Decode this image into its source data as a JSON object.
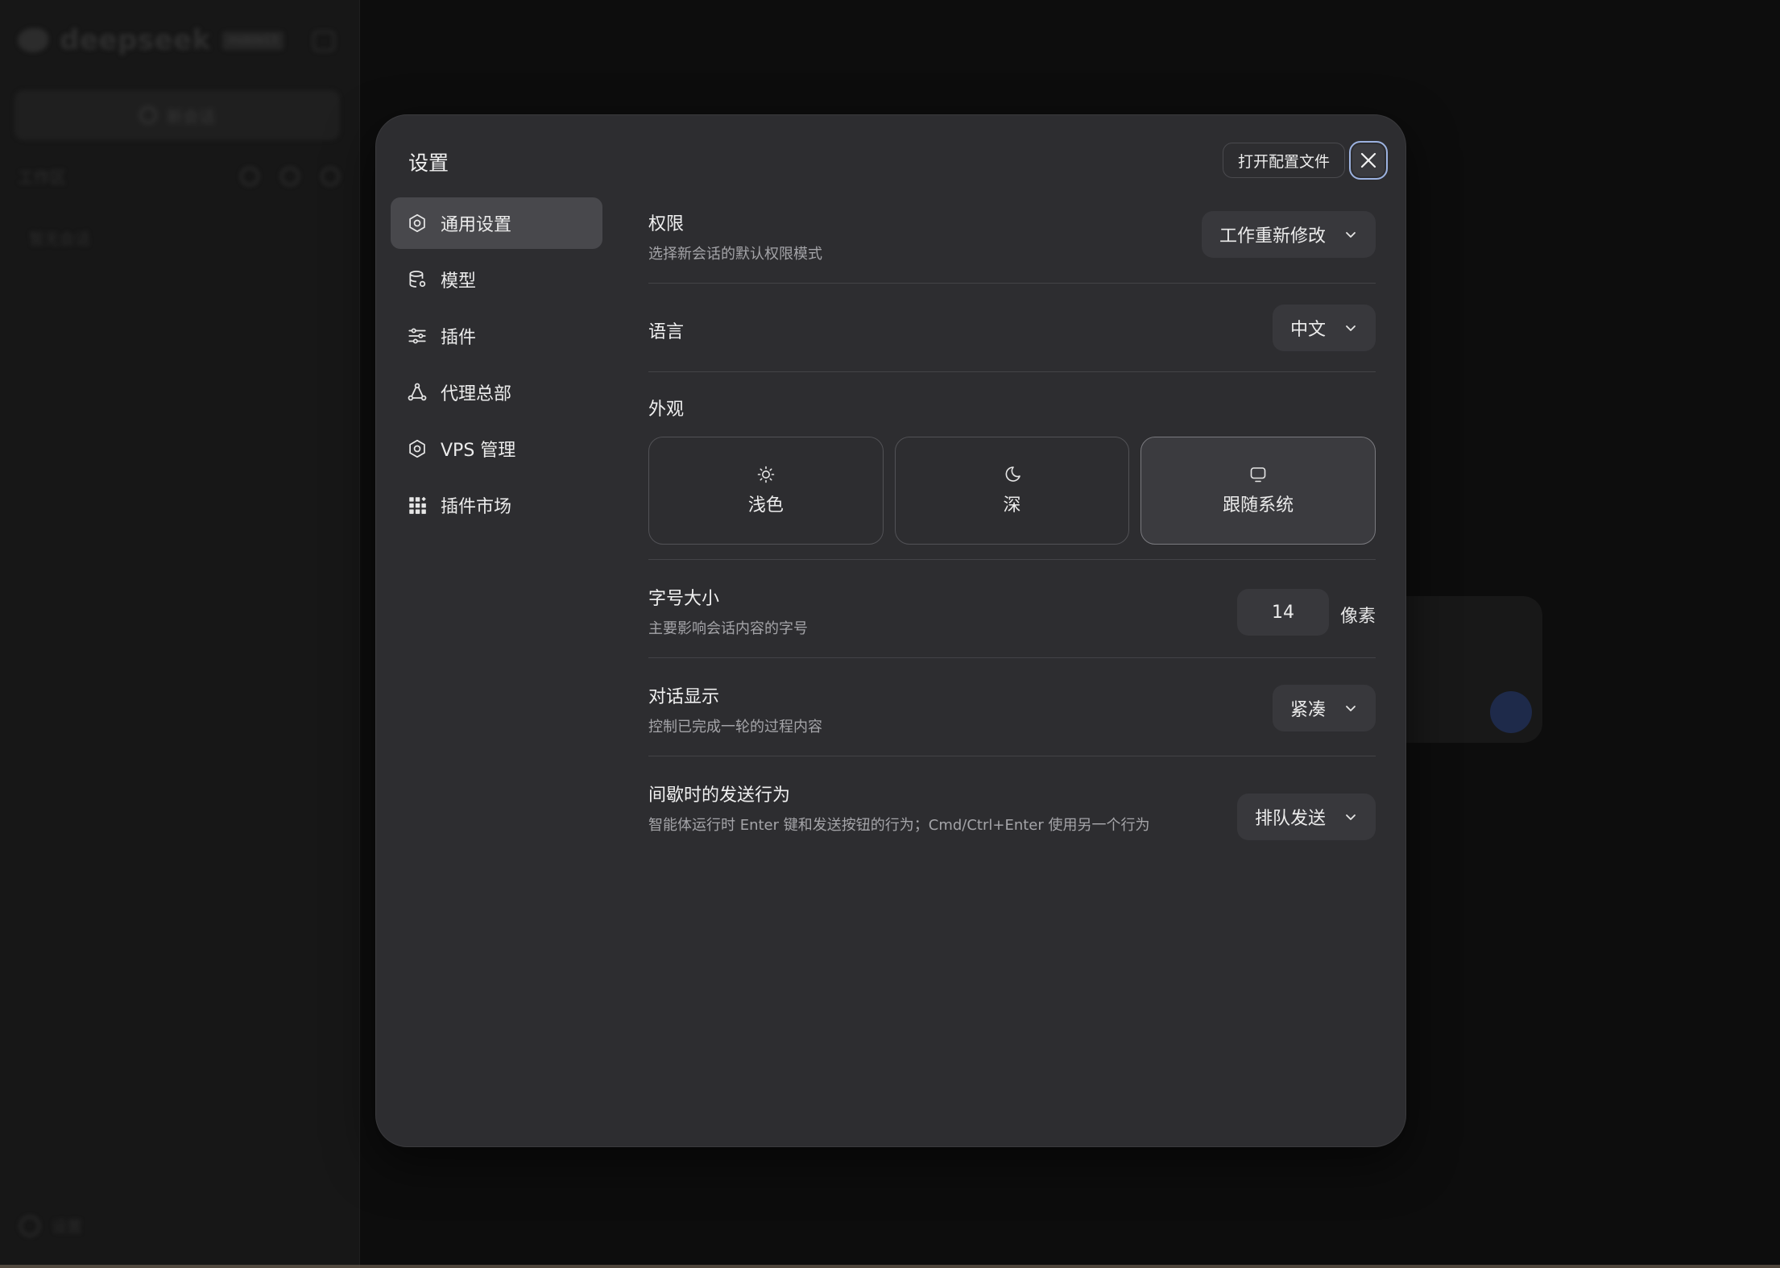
{
  "background": {
    "brand": "deepseek",
    "version": "mobile13",
    "new_chat": "新会话",
    "workspace": "工作区",
    "empty": "暂无会话",
    "settings": "设置"
  },
  "modal": {
    "title": "设置",
    "open_config": "打开配置文件",
    "nav": [
      {
        "label": "通用设置",
        "icon": "gear-icon"
      },
      {
        "label": "模型",
        "icon": "database-icon"
      },
      {
        "label": "插件",
        "icon": "sliders-icon"
      },
      {
        "label": "代理总部",
        "icon": "network-icon"
      },
      {
        "label": "VPS 管理",
        "icon": "gear-icon"
      },
      {
        "label": "插件市场",
        "icon": "grid-icon"
      }
    ],
    "permission": {
      "label": "权限",
      "desc": "选择新会话的默认权限模式",
      "value": "工作重新修改"
    },
    "language": {
      "label": "语言",
      "value": "中文"
    },
    "appearance": {
      "label": "外观",
      "options": [
        {
          "label": "浅色",
          "icon": "sun-icon"
        },
        {
          "label": "深",
          "icon": "moon-icon"
        },
        {
          "label": "跟随系统",
          "icon": "monitor-icon"
        }
      ],
      "selected": "跟随系统"
    },
    "font_size": {
      "label": "字号大小",
      "desc": "主要影响会话内容的字号",
      "value": "14",
      "unit": "像素"
    },
    "dialog_display": {
      "label": "对话显示",
      "desc": "控制已完成一轮的过程内容",
      "value": "紧凑"
    },
    "send_behavior": {
      "label": "间歇时的发送行为",
      "desc": "智能体运行时 Enter 键和发送按钮的行为；Cmd/Ctrl+Enter 使用另一个行为",
      "value": "排队发送"
    }
  },
  "colors": {
    "backdrop": "#0d0d0d",
    "modal_bg": "#2d2d30",
    "active_nav": "#48484c",
    "focus_ring": "#9cb2e0"
  }
}
